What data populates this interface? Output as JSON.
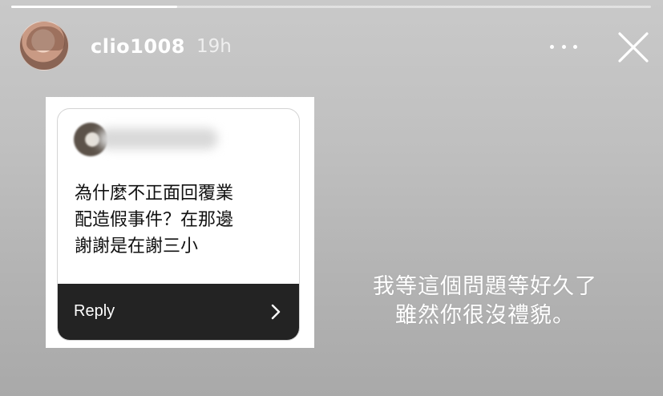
{
  "story": {
    "progress_fraction": 0.26
  },
  "header": {
    "username": "clio1008",
    "time_ago": "19h",
    "more_icon": "more-horizontal-icon",
    "close_icon": "close-icon"
  },
  "question_sticker": {
    "question_text": "為什麼不正面回覆業\n配造假事件？在那邊\n謝謝是在謝三小",
    "reply_label": "Reply",
    "reply_icon": "chevron-right-icon"
  },
  "caption": {
    "lines": [
      "我等這個問題等好久了",
      "雖然你很沒禮貌。"
    ]
  },
  "colors": {
    "background_top": "#c9c9c9",
    "background_bottom": "#a9a9a9",
    "reply_bar": "#232323",
    "text_white": "#ffffff"
  }
}
